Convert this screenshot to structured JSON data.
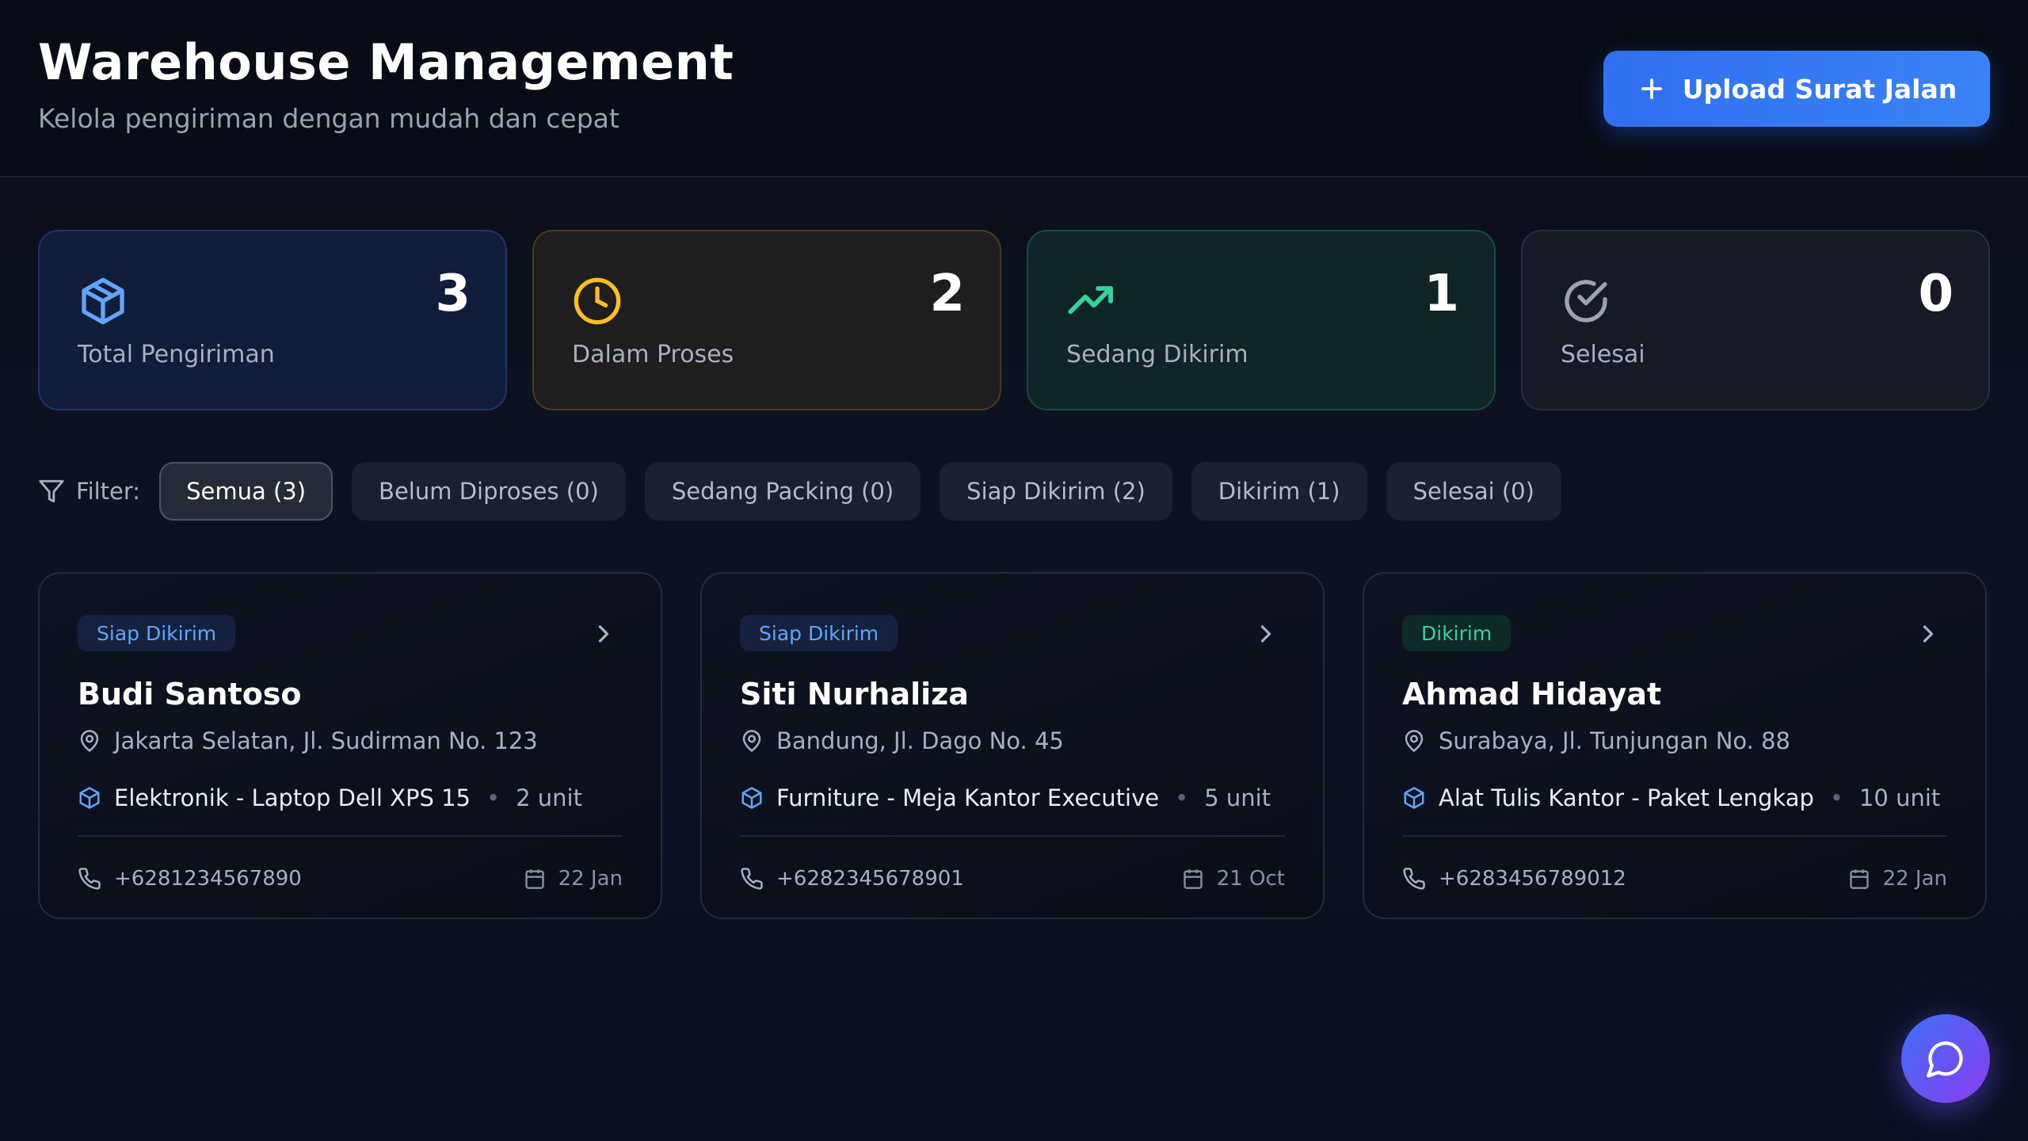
{
  "header": {
    "title": "Warehouse Management",
    "subtitle": "Kelola pengiriman dengan mudah dan cepat",
    "upload_label": "Upload Surat Jalan"
  },
  "stats": [
    {
      "label": "Total Pengiriman",
      "value": "3",
      "icon": "package-icon",
      "color": "#60a5fa"
    },
    {
      "label": "Dalam Proses",
      "value": "2",
      "icon": "clock-icon",
      "color": "#fbbf24"
    },
    {
      "label": "Sedang Dikirim",
      "value": "1",
      "icon": "trending-up-icon",
      "color": "#34d399"
    },
    {
      "label": "Selesai",
      "value": "0",
      "icon": "check-circle-icon",
      "color": "#9ca3af"
    }
  ],
  "filter": {
    "label": "Filter:",
    "chips": [
      {
        "label": "Semua (3)",
        "active": true
      },
      {
        "label": "Belum Diproses (0)",
        "active": false
      },
      {
        "label": "Sedang Packing (0)",
        "active": false
      },
      {
        "label": "Siap Dikirim (2)",
        "active": false
      },
      {
        "label": "Dikirim (1)",
        "active": false
      },
      {
        "label": "Selesai (0)",
        "active": false
      }
    ]
  },
  "shipments": [
    {
      "status": "Siap Dikirim",
      "status_color": "#60a5fa",
      "name": "Budi Santoso",
      "address": "Jakarta Selatan, Jl. Sudirman No. 123",
      "item": "Elektronik - Laptop Dell XPS 15",
      "qty": "2 unit",
      "phone": "+6281234567890",
      "date": "22 Jan"
    },
    {
      "status": "Siap Dikirim",
      "status_color": "#60a5fa",
      "name": "Siti Nurhaliza",
      "address": "Bandung, Jl. Dago No. 45",
      "item": "Furniture - Meja Kantor Executive",
      "qty": "5 unit",
      "phone": "+6282345678901",
      "date": "21 Oct"
    },
    {
      "status": "Dikirim",
      "status_color": "#34d399",
      "name": "Ahmad Hidayat",
      "address": "Surabaya, Jl. Tunjungan No. 88",
      "item": "Alat Tulis Kantor - Paket Lengkap",
      "qty": "10 unit",
      "phone": "+6283456789012",
      "date": "22 Jan"
    }
  ],
  "chat": {
    "icon": "chat-bubble-icon"
  }
}
